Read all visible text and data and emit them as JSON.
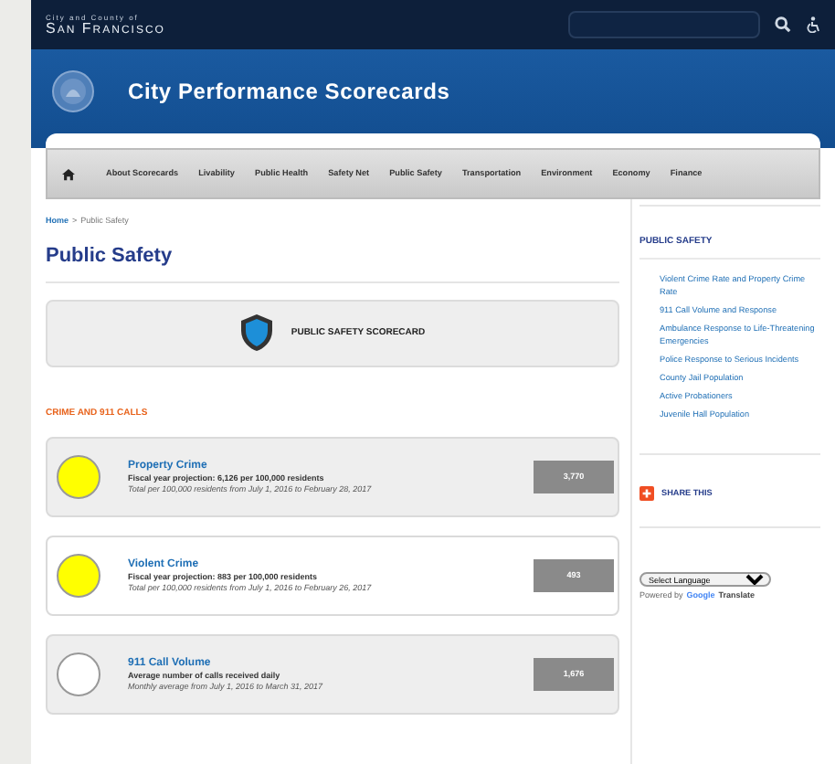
{
  "top_bar": {
    "org_small": "City and County of",
    "org_name": "San Francisco"
  },
  "header": {
    "title": "City Performance Scorecards"
  },
  "nav": {
    "items": [
      {
        "label": "About Scorecards",
        "selected": false
      },
      {
        "label": "Livability",
        "selected": false
      },
      {
        "label": "Public Health",
        "selected": false
      },
      {
        "label": "Safety Net",
        "selected": false
      },
      {
        "label": "Public Safety",
        "selected": false
      },
      {
        "label": "Transportation",
        "selected": false
      },
      {
        "label": "Environment",
        "selected": false
      },
      {
        "label": "Economy",
        "selected": false
      },
      {
        "label": "Finance",
        "selected": false
      }
    ]
  },
  "breadcrumb": {
    "link": "Home",
    "separator": ">",
    "current": "Public Safety"
  },
  "page_title": "Public Safety",
  "scorecard_banner": "PUBLIC SAFETY SCORECARD",
  "section_title": "CRIME AND 911 CALLS",
  "measures": [
    {
      "title": "Property Crime",
      "subtitle": "Fiscal year projection: 6,126 per 100,000 residents",
      "note": "Total per 100,000 residents from July 1, 2016 to February 28, 2017",
      "value": "3,770",
      "color": "#ffff00"
    },
    {
      "title": "Violent Crime",
      "subtitle": "Fiscal year projection: 883 per 100,000 residents",
      "note": "Total per 100,000 residents from July 1, 2016 to February 26, 2017",
      "value": "493",
      "color": "#ffff00"
    },
    {
      "title": "911 Call Volume",
      "subtitle": "Average number of calls received daily",
      "note": "Monthly average from July 1, 2016 to March 31, 2017",
      "value": "1,676",
      "color": "#ffffff"
    }
  ],
  "sidebar": {
    "title": "PUBLIC SAFETY",
    "links": [
      "Violent Crime Rate and Property Crime Rate",
      "911 Call Volume and Response",
      "Ambulance Response to Life-Threatening Emergencies",
      "Police Response to Serious Incidents",
      "County Jail Population",
      "Active Probationers",
      "Juvenile Hall Population"
    ],
    "share": "SHARE THIS",
    "language_select": "Select Language",
    "powered_by": "Powered by",
    "translate_brand": "Google",
    "translate_label": "Translate"
  }
}
